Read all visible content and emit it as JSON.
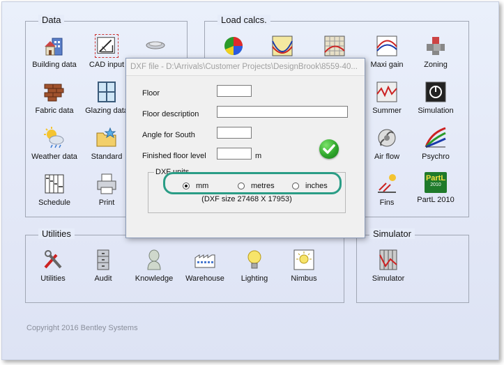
{
  "groups": {
    "data": {
      "title": "Data",
      "items": [
        "Building data",
        "CAD input",
        "Fabric data",
        "Glazing data",
        "Weather data",
        "Standard",
        "Schedule",
        "Print"
      ]
    },
    "load_calcs": {
      "title": "Load calcs.",
      "items": [
        "Maxi gain",
        "Zoning",
        "Summer",
        "Simulation",
        "Air flow",
        "Psychro",
        "Fins",
        "PartL 2010"
      ]
    },
    "utilities": {
      "title": "Utilities",
      "items": [
        "Utilities",
        "Audit",
        "Knowledge",
        "Warehouse",
        "Lighting",
        "Nimbus"
      ]
    },
    "simulator": {
      "title": "Simulator",
      "items": [
        "Simulator"
      ]
    }
  },
  "partl_badge": {
    "line1": "PartL",
    "line2": "2010"
  },
  "copyright": "Copyright 2016 Bentley Systems",
  "dialog": {
    "title": "DXF file - D:\\Arrivals\\Customer Projects\\DesignBrook\\8559-40...",
    "fields": {
      "floor": {
        "label": "Floor",
        "value": ""
      },
      "floor_description": {
        "label": "Floor description",
        "value": ""
      },
      "angle_for_south": {
        "label": "Angle for South",
        "value": ""
      },
      "finished_floor_level": {
        "label": "Finished floor level",
        "value": "",
        "unit": "m"
      }
    },
    "dxf_units": {
      "legend": "DXF units",
      "options": [
        "mm",
        "metres",
        "inches"
      ],
      "selected": "mm"
    },
    "dxf_size": "(DXF size  27468  X  17953)"
  },
  "colors": {
    "accent_highlight": "#2a9d86",
    "ok_green": "#2fa62c"
  }
}
